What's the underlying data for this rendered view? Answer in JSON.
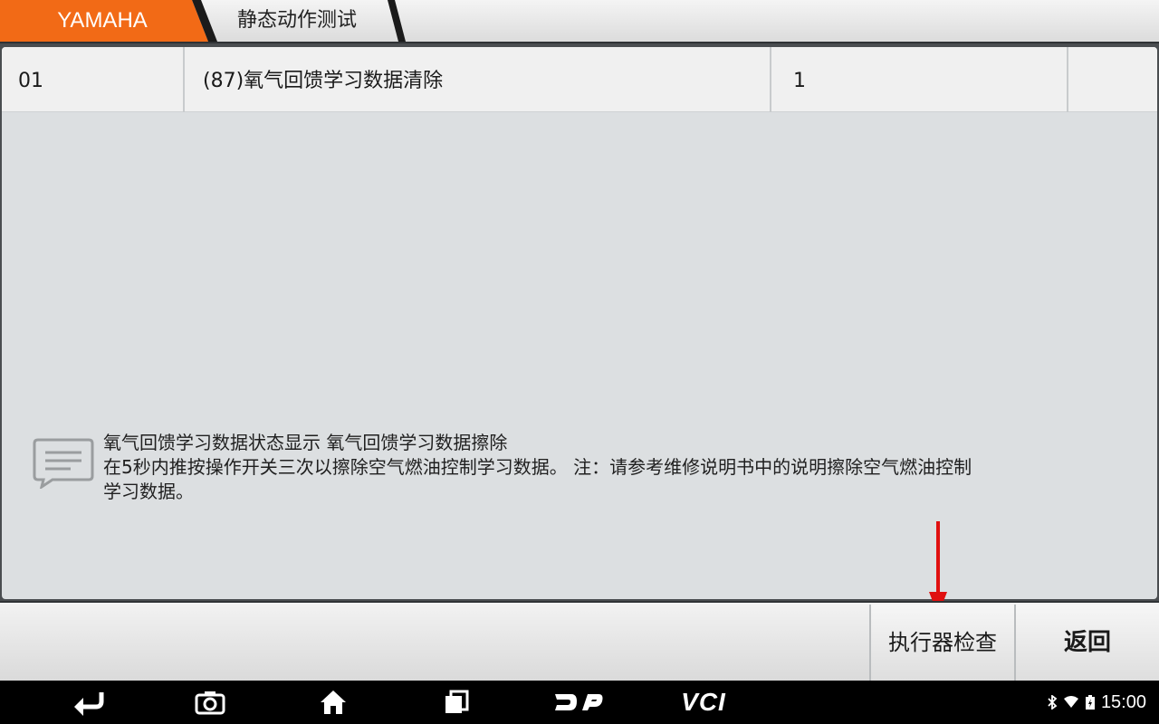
{
  "breadcrumb": {
    "brand": "YAMAHA",
    "page": "静态动作测试"
  },
  "colors": {
    "accent": "#f26a16",
    "panel": "#dcdfe1",
    "arrow": "#e01010"
  },
  "table": {
    "row": {
      "id": "01",
      "name": "(87)氧气回馈学习数据清除",
      "value": "1",
      "extra": ""
    }
  },
  "message": {
    "icon": "message-icon",
    "lines": [
      "氧气回馈学习数据状态显示 氧气回馈学习数据擦除",
      "在5秒内推按操作开关三次以擦除空气燃油控制学习数据。 注：请参考维修说明书中的说明擦除空气燃油控制",
      "学习数据。"
    ]
  },
  "buttons": {
    "actuator": "执行器检查",
    "back": "返回"
  },
  "navbar": {
    "items": [
      "back-icon",
      "camera-icon",
      "home-icon",
      "recent-apps-icon",
      "dp-logo",
      "vci-logo"
    ],
    "dp": "DP",
    "vci": "VCI",
    "status_icons": [
      "bluetooth-icon",
      "wifi-icon",
      "battery-icon"
    ],
    "time": "15:00"
  }
}
